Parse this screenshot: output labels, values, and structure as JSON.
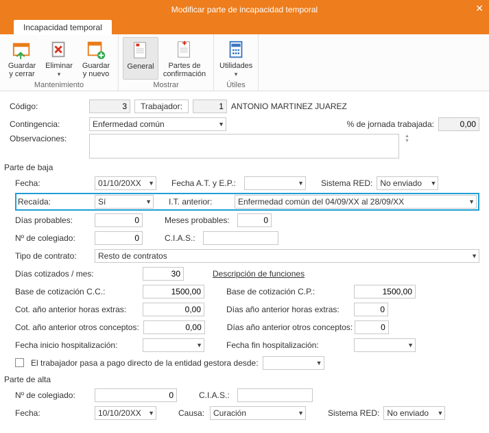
{
  "window": {
    "title": "Modificar parte de incapacidad temporal"
  },
  "tab": {
    "label": "Incapacidad temporal"
  },
  "ribbon": {
    "maint": {
      "save_close": "Guardar y cerrar",
      "delete": "Eliminar",
      "save_new": "Guardar y nuevo",
      "group": "Mantenimiento"
    },
    "show": {
      "general": "General",
      "partes": "Partes de confirmación",
      "group": "Mostrar"
    },
    "utils": {
      "utilidades": "Utilidades",
      "group": "Útiles"
    }
  },
  "fields": {
    "codigo_lbl": "Código:",
    "codigo_val": "3",
    "trabajador_lbl": "Trabajador:",
    "trabajador_num": "1",
    "trabajador_name": "ANTONIO MARTINEZ JUAREZ",
    "contingencia_lbl": "Contingencia:",
    "contingencia_val": "Enfermedad común",
    "pct_lbl": "% de jornada trabajada:",
    "pct_val": "0,00",
    "obs_lbl": "Observaciones:",
    "obs_val": ""
  },
  "baja": {
    "section": "Parte de baja",
    "fecha_lbl": "Fecha:",
    "fecha_val": "01/10/20XX",
    "fecha_at_lbl": "Fecha A.T. y E.P.:",
    "fecha_at_val": "",
    "sistema_red_lbl": "Sistema RED:",
    "sistema_red_val": "No enviado",
    "recaida_lbl": "Recaída:",
    "recaida_val": "Sí",
    "it_ant_lbl": "I.T. anterior:",
    "it_ant_val": "Enfermedad común del 04/09/XX al 28/09/XX",
    "dias_prob_lbl": "Días probables:",
    "dias_prob_val": "0",
    "meses_prob_lbl": "Meses probables:",
    "meses_prob_val": "0",
    "coleg_lbl": "Nº de colegiado:",
    "coleg_val": "0",
    "cias_lbl": "C.I.A.S.:",
    "cias_val": "",
    "tipo_contrato_lbl": "Tipo de contrato:",
    "tipo_contrato_val": "Resto de contratos",
    "dias_cot_lbl": "Días cotizados / mes:",
    "dias_cot_val": "30",
    "desc_func_lbl": "Descripción de funciones",
    "base_cc_lbl": "Base de cotización C.C.:",
    "base_cc_val": "1500,00",
    "base_cp_lbl": "Base de cotización C.P.:",
    "base_cp_val": "1500,00",
    "cot_he_lbl": "Cot. año anterior horas extras:",
    "cot_he_val": "0,00",
    "dias_he_lbl": "Días año anterior horas extras:",
    "dias_he_val": "0",
    "cot_oc_lbl": "Cot. año anterior otros conceptos:",
    "cot_oc_val": "0,00",
    "dias_oc_lbl": "Días año anterior otros conceptos:",
    "dias_oc_val": "0",
    "f_ini_hosp_lbl": "Fecha inicio hospitalización:",
    "f_ini_hosp_val": "",
    "f_fin_hosp_lbl": "Fecha fin hospitalización:",
    "f_fin_hosp_val": "",
    "pago_directo_lbl": "El trabajador pasa a pago directo de la entidad gestora desde:",
    "pago_directo_val": ""
  },
  "alta": {
    "section": "Parte de alta",
    "coleg_lbl": "Nº de colegiado:",
    "coleg_val": "0",
    "cias_lbl": "C.I.A.S.:",
    "cias_val": "",
    "fecha_lbl": "Fecha:",
    "fecha_val": "10/10/20XX",
    "causa_lbl": "Causa:",
    "causa_val": "Curación",
    "sistema_red_lbl": "Sistema RED:",
    "sistema_red_val": "No enviado"
  }
}
